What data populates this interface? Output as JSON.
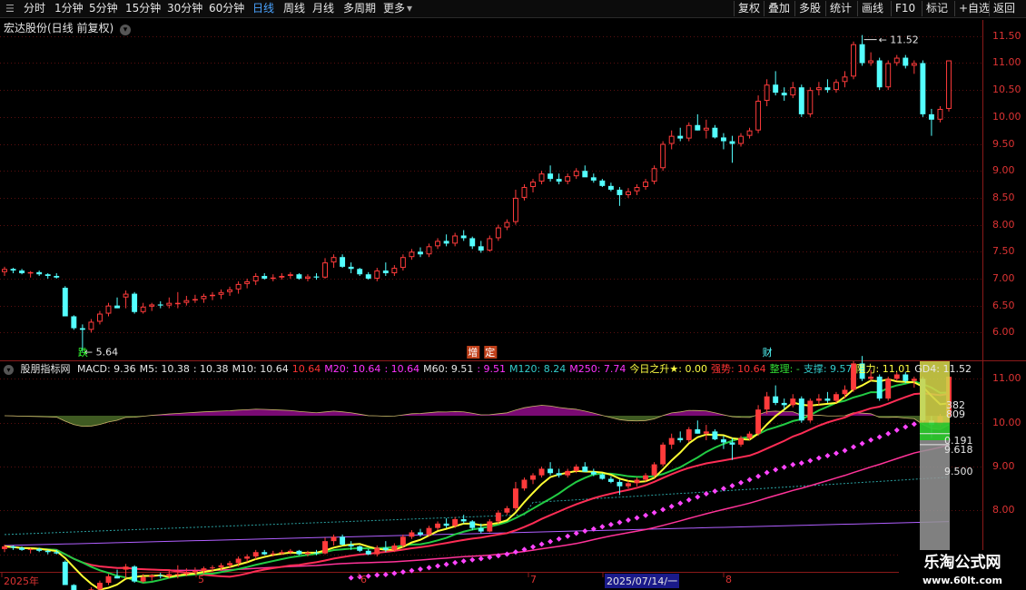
{
  "toolbar": {
    "left_tabs": [
      "分时",
      "1分钟",
      "5分钟",
      "15分钟",
      "30分钟",
      "60分钟",
      "日线",
      "周线",
      "月线",
      "多周期",
      "更多"
    ],
    "active_tab": "日线",
    "right_tools": [
      "复权",
      "叠加",
      "多股",
      "统计",
      "画线",
      "F10",
      "标记",
      "+自选",
      "返回"
    ]
  },
  "price_panel": {
    "title": "宏达股份(日线 前复权)",
    "y_ticks": [
      "11.50",
      "11.00",
      "10.50",
      "10.00",
      "9.50",
      "9.00",
      "8.50",
      "8.00",
      "7.50",
      "7.00",
      "6.50",
      "6.00"
    ],
    "high_label": "11.52",
    "low_label": "5.64",
    "markers": [
      "跌",
      "增",
      "定",
      "财"
    ]
  },
  "indicator_panel": {
    "name": "股朋指标网",
    "legend": [
      {
        "text": "MACD: 9.36",
        "color": "#e6e6e6"
      },
      {
        "text": "M5: 10.38",
        "color": "#e6e6e6"
      },
      {
        "text": ": 10.38",
        "color": "#e6e6e6"
      },
      {
        "text": "M10: 10.64",
        "color": "#e6e6e6"
      },
      {
        "text": "10.64",
        "color": "#ff3333"
      },
      {
        "text": "M20: 10.64",
        "color": "#ff33ff"
      },
      {
        "text": ": 10.64",
        "color": "#ff33ff"
      },
      {
        "text": "M60: 9.51",
        "color": "#e6e6e6"
      },
      {
        "text": ": 9.51",
        "color": "#ff33ff"
      },
      {
        "text": "M120: 8.24",
        "color": "#33cccc"
      },
      {
        "text": "M250: 7.74",
        "color": "#ff33ff"
      },
      {
        "text": "今日之升★: 0.00",
        "color": "#ffff44"
      },
      {
        "text": "强势: 10.64",
        "color": "#ff3333"
      },
      {
        "text": "整理: -",
        "color": "#33dd33"
      },
      {
        "text": "支撑: 9.57",
        "color": "#33cccc"
      },
      {
        "text": "阻力: 11.01",
        "color": "#ffff44"
      },
      {
        "text": "GD4: 11.52",
        "color": "#e6e6e6"
      }
    ],
    "y_ticks": [
      "11.00",
      "10.00",
      "9.00",
      "8.00",
      "7.00"
    ],
    "fib_labels": [
      "382",
      "809",
      "0.191",
      "9.618",
      "9.500"
    ]
  },
  "x_axis": {
    "labels": [
      "2025年",
      "5",
      "6",
      "7",
      "2025/07/14/一",
      "8"
    ]
  },
  "watermark": {
    "line1": "乐淘公式网",
    "line2": "www.60lt.com"
  },
  "chart_data": {
    "type": "candlestick",
    "title": "宏达股份(日线 前复权)",
    "ylim": [
      5.5,
      11.8
    ],
    "candles": [
      [
        7.12,
        7.22,
        7.05,
        7.18
      ],
      [
        7.18,
        7.2,
        7.1,
        7.15
      ],
      [
        7.15,
        7.18,
        7.08,
        7.1
      ],
      [
        7.1,
        7.14,
        7.02,
        7.12
      ],
      [
        7.12,
        7.15,
        7.05,
        7.08
      ],
      [
        7.08,
        7.1,
        7.0,
        7.05
      ],
      [
        7.05,
        7.1,
        7.0,
        7.02
      ],
      [
        6.83,
        6.86,
        6.55,
        6.3
      ],
      [
        6.3,
        6.32,
        6.05,
        6.08
      ],
      [
        6.08,
        6.15,
        5.64,
        6.05
      ],
      [
        6.05,
        6.25,
        6.0,
        6.2
      ],
      [
        6.2,
        6.4,
        6.15,
        6.35
      ],
      [
        6.35,
        6.55,
        6.3,
        6.5
      ],
      [
        6.5,
        6.65,
        6.45,
        6.45
      ],
      [
        6.65,
        6.78,
        6.45,
        6.72
      ],
      [
        6.72,
        6.75,
        6.35,
        6.38
      ],
      [
        6.38,
        6.55,
        6.35,
        6.48
      ],
      [
        6.48,
        6.55,
        6.4,
        6.52
      ],
      [
        6.52,
        6.58,
        6.45,
        6.5
      ],
      [
        6.5,
        6.65,
        6.45,
        6.55
      ],
      [
        6.55,
        6.75,
        6.45,
        6.55
      ],
      [
        6.55,
        6.68,
        6.5,
        6.6
      ],
      [
        6.6,
        6.7,
        6.55,
        6.62
      ],
      [
        6.62,
        6.72,
        6.55,
        6.68
      ],
      [
        6.68,
        6.75,
        6.6,
        6.7
      ],
      [
        6.7,
        6.8,
        6.62,
        6.75
      ],
      [
        6.75,
        6.85,
        6.68,
        6.8
      ],
      [
        6.8,
        6.95,
        6.72,
        6.9
      ],
      [
        6.9,
        7.0,
        6.82,
        6.95
      ],
      [
        6.95,
        7.1,
        6.88,
        7.05
      ],
      [
        7.05,
        7.1,
        6.98,
        7.0
      ],
      [
        7.0,
        7.08,
        6.95,
        7.02
      ],
      [
        7.02,
        7.1,
        6.98,
        7.05
      ],
      [
        7.05,
        7.12,
        7.0,
        7.08
      ],
      [
        7.08,
        7.1,
        6.98,
        7.0
      ],
      [
        7.0,
        7.08,
        6.95,
        7.04
      ],
      [
        7.04,
        7.1,
        6.98,
        7.02
      ],
      [
        7.02,
        7.38,
        7.0,
        7.3
      ],
      [
        7.3,
        7.45,
        7.2,
        7.4
      ],
      [
        7.4,
        7.45,
        7.2,
        7.22
      ],
      [
        7.22,
        7.3,
        7.1,
        7.18
      ],
      [
        7.18,
        7.2,
        7.05,
        7.08
      ],
      [
        7.08,
        7.12,
        6.98,
        7.0
      ],
      [
        7.0,
        7.2,
        6.95,
        7.15
      ],
      [
        7.15,
        7.3,
        7.05,
        7.1
      ],
      [
        7.1,
        7.25,
        7.05,
        7.2
      ],
      [
        7.2,
        7.45,
        7.15,
        7.4
      ],
      [
        7.4,
        7.55,
        7.35,
        7.5
      ],
      [
        7.5,
        7.58,
        7.4,
        7.45
      ],
      [
        7.45,
        7.65,
        7.4,
        7.6
      ],
      [
        7.6,
        7.75,
        7.55,
        7.7
      ],
      [
        7.7,
        7.82,
        7.6,
        7.65
      ],
      [
        7.65,
        7.85,
        7.6,
        7.8
      ],
      [
        7.8,
        7.9,
        7.7,
        7.75
      ],
      [
        7.75,
        7.78,
        7.55,
        7.6
      ],
      [
        7.6,
        7.7,
        7.48,
        7.52
      ],
      [
        7.52,
        7.8,
        7.5,
        7.75
      ],
      [
        7.75,
        8.0,
        7.7,
        7.95
      ],
      [
        7.95,
        8.1,
        7.9,
        8.05
      ],
      [
        8.05,
        8.65,
        8.0,
        8.5
      ],
      [
        8.5,
        8.75,
        8.45,
        8.7
      ],
      [
        8.7,
        8.85,
        8.6,
        8.8
      ],
      [
        8.8,
        9.0,
        8.75,
        8.95
      ],
      [
        8.95,
        9.1,
        8.8,
        8.85
      ],
      [
        8.85,
        8.95,
        8.75,
        8.8
      ],
      [
        8.8,
        8.95,
        8.75,
        8.9
      ],
      [
        8.9,
        9.05,
        8.85,
        9.0
      ],
      [
        9.0,
        9.1,
        8.9,
        8.88
      ],
      [
        8.88,
        8.95,
        8.78,
        8.82
      ],
      [
        8.82,
        8.85,
        8.7,
        8.72
      ],
      [
        8.72,
        8.78,
        8.62,
        8.65
      ],
      [
        8.65,
        8.7,
        8.35,
        8.55
      ],
      [
        8.55,
        8.68,
        8.5,
        8.62
      ],
      [
        8.62,
        8.75,
        8.55,
        8.7
      ],
      [
        8.7,
        8.85,
        8.65,
        8.8
      ],
      [
        8.8,
        9.1,
        8.75,
        9.05
      ],
      [
        9.05,
        9.55,
        9.0,
        9.5
      ],
      [
        9.5,
        9.75,
        9.4,
        9.65
      ],
      [
        9.65,
        9.8,
        9.55,
        9.6
      ],
      [
        9.6,
        9.9,
        9.55,
        9.85
      ],
      [
        9.85,
        10.05,
        9.75,
        9.75
      ],
      [
        9.75,
        9.95,
        9.6,
        9.8
      ],
      [
        9.8,
        9.85,
        9.6,
        9.62
      ],
      [
        9.62,
        9.7,
        9.4,
        9.55
      ],
      [
        9.55,
        9.65,
        9.15,
        9.5
      ],
      [
        9.5,
        9.7,
        9.45,
        9.65
      ],
      [
        9.65,
        9.8,
        9.6,
        9.75
      ],
      [
        9.75,
        10.4,
        9.7,
        10.3
      ],
      [
        10.3,
        10.7,
        10.2,
        10.6
      ],
      [
        10.6,
        10.85,
        10.4,
        10.45
      ],
      [
        10.45,
        10.55,
        10.3,
        10.4
      ],
      [
        10.4,
        10.65,
        10.35,
        10.55
      ],
      [
        10.55,
        10.6,
        10.0,
        10.05
      ],
      [
        10.05,
        10.55,
        10.0,
        10.5
      ],
      [
        10.5,
        10.65,
        10.4,
        10.55
      ],
      [
        10.55,
        10.7,
        10.45,
        10.5
      ],
      [
        10.5,
        10.7,
        10.45,
        10.65
      ],
      [
        10.65,
        10.85,
        10.55,
        10.75
      ],
      [
        10.75,
        11.4,
        10.7,
        11.35
      ],
      [
        11.35,
        11.52,
        10.95,
        11.0
      ],
      [
        11.0,
        11.2,
        10.95,
        11.05
      ],
      [
        11.05,
        11.1,
        10.5,
        10.55
      ],
      [
        10.55,
        11.05,
        10.5,
        11.0
      ],
      [
        11.0,
        11.15,
        10.95,
        11.1
      ],
      [
        11.1,
        11.15,
        10.9,
        10.95
      ],
      [
        10.95,
        11.05,
        10.8,
        11.0
      ],
      [
        11.0,
        11.05,
        10.0,
        10.05
      ],
      [
        10.05,
        10.15,
        9.65,
        9.95
      ],
      [
        9.95,
        10.2,
        9.9,
        10.15
      ],
      [
        10.15,
        11.05,
        10.1,
        11.05
      ]
    ]
  }
}
